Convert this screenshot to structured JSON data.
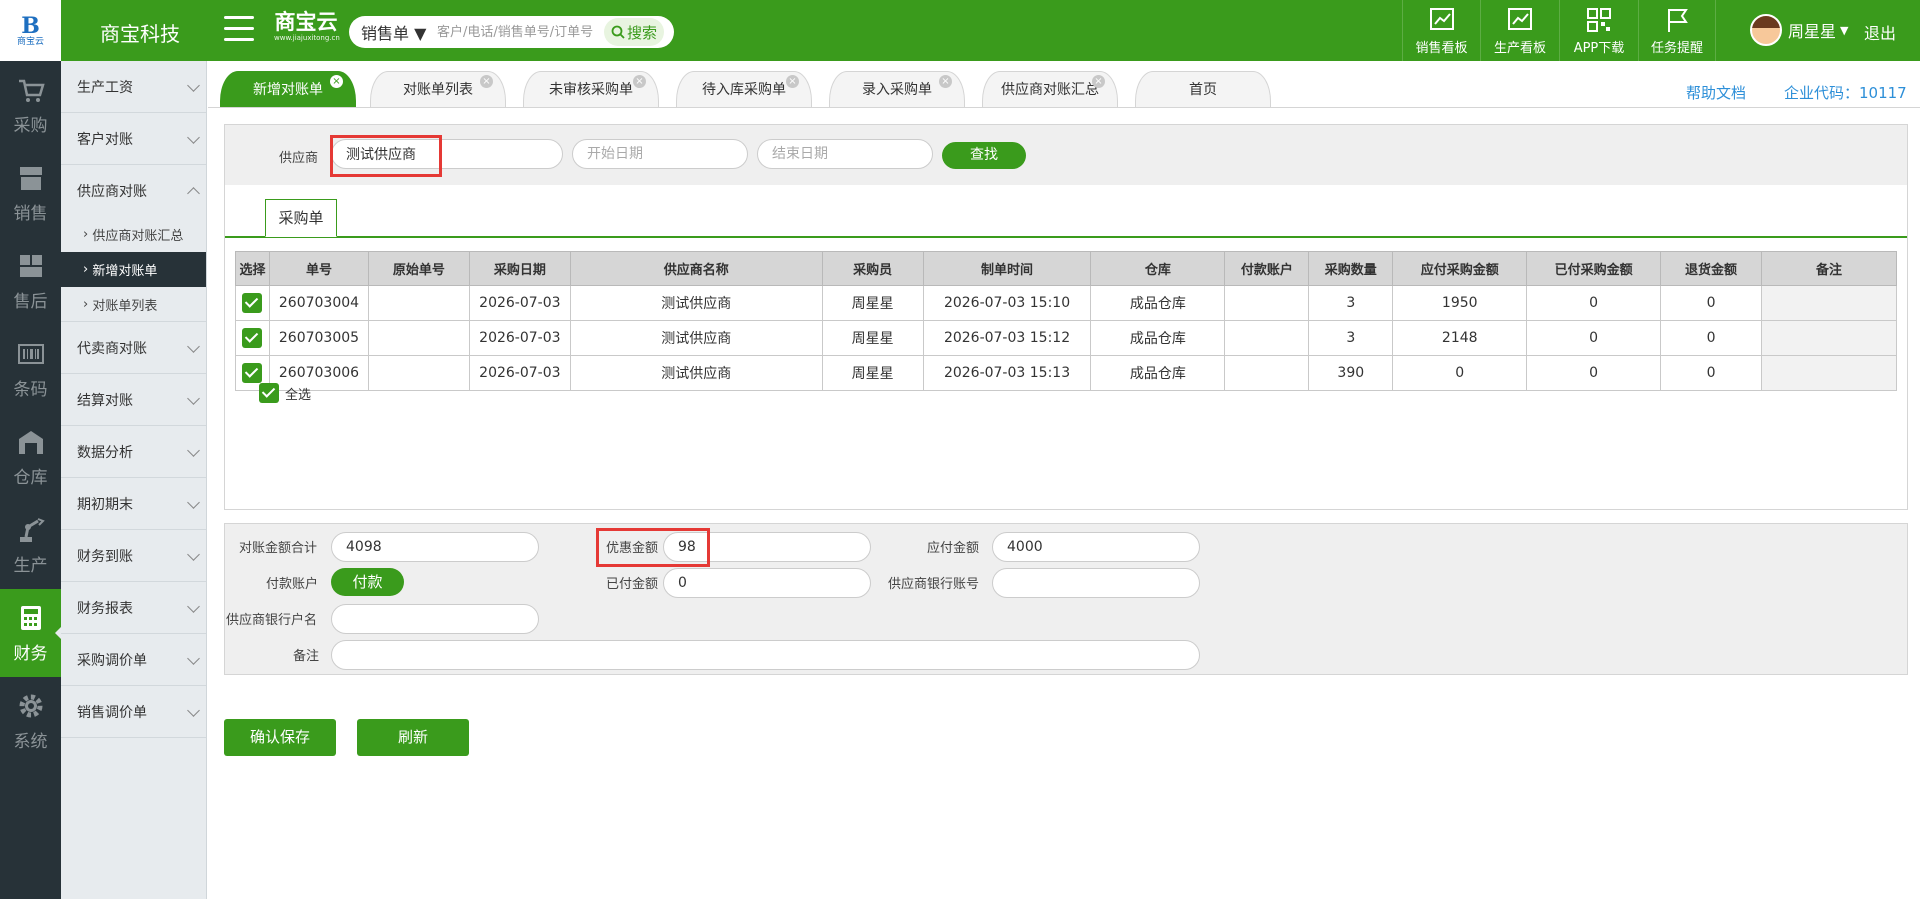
{
  "header": {
    "logo_text": "商宝云",
    "company": "商宝科技",
    "brand": "商宝云",
    "brand_url": "www.jiajuxitong.cn",
    "search": {
      "type": "销售单 ▼",
      "placeholder": "客户/电话/销售单号/订单号",
      "button": "搜索"
    },
    "nav": [
      "销售看板",
      "生产看板",
      "APP下载",
      "任务提醒"
    ],
    "user": "周星星",
    "logout": "退出"
  },
  "iconbar": [
    {
      "label": "采购",
      "icon": "cart-icon"
    },
    {
      "label": "销售",
      "icon": "store-icon"
    },
    {
      "label": "售后",
      "icon": "service-icon"
    },
    {
      "label": "条码",
      "icon": "barcode-icon"
    },
    {
      "label": "仓库",
      "icon": "warehouse-icon"
    },
    {
      "label": "生产",
      "icon": "robot-arm-icon"
    },
    {
      "label": "财务",
      "icon": "calculator-icon"
    },
    {
      "label": "系统",
      "icon": "gear-icon"
    }
  ],
  "menu": {
    "items": [
      "生产工资",
      "客户对账",
      "供应商对账"
    ],
    "subitems": [
      "供应商对账汇总",
      "新增对账单",
      "对账单列表"
    ],
    "items_after": [
      "代卖商对账",
      "结算对账",
      "数据分析",
      "期初期末",
      "财务到账",
      "财务报表",
      "采购调价单",
      "销售调价单"
    ]
  },
  "tabs": [
    "新增对账单",
    "对账单列表",
    "未审核采购单",
    "待入库采购单",
    "录入采购单",
    "供应商对账汇总",
    "首页"
  ],
  "help": "帮助文档",
  "corp": "企业代码：10117",
  "filter": {
    "supplier_label": "供应商",
    "supplier_value": "测试供应商",
    "start_placeholder": "开始日期",
    "end_placeholder": "结束日期",
    "search_button": "查找"
  },
  "subtab": "采购单",
  "table": {
    "columns": [
      "选择",
      "单号",
      "原始单号",
      "采购日期",
      "供应商名称",
      "采购员",
      "制单时间",
      "仓库",
      "付款账户",
      "采购数量",
      "应付采购金额",
      "已付采购金额",
      "退货金额",
      "备注"
    ],
    "rows": [
      [
        "",
        "260703004",
        "",
        "2026-07-03",
        "测试供应商",
        "周星星",
        "2026-07-03 15:10",
        "成品仓库",
        "",
        "3",
        "1950",
        "0",
        "0",
        ""
      ],
      [
        "",
        "260703005",
        "",
        "2026-07-03",
        "测试供应商",
        "周星星",
        "2026-07-03 15:12",
        "成品仓库",
        "",
        "3",
        "2148",
        "0",
        "0",
        ""
      ],
      [
        "",
        "260703006",
        "",
        "2026-07-03",
        "测试供应商",
        "周星星",
        "2026-07-03 15:13",
        "成品仓库",
        "",
        "390",
        "0",
        "0",
        "0",
        ""
      ]
    ]
  },
  "select_all": "全选",
  "summary": {
    "total_label": "对账金额合计",
    "total_value": "4098",
    "discount_label": "优惠金额",
    "discount_value": "98",
    "payable_label": "应付金额",
    "payable_value": "4000",
    "account_label": "付款账户",
    "account_button": "付款",
    "paid_label": "已付金额",
    "paid_value": "0",
    "bank_no_label": "供应商银行账号",
    "bank_no_value": "",
    "bank_name_label": "供应商银行户名",
    "bank_name_value": "",
    "note_label": "备注",
    "note_value": ""
  },
  "buttons": {
    "save": "确认保存",
    "refresh": "刷新"
  },
  "colors": {
    "green": "#3a9b1c",
    "dark": "#273238",
    "link": "#2d8fd8",
    "highlight": "#e53935"
  }
}
